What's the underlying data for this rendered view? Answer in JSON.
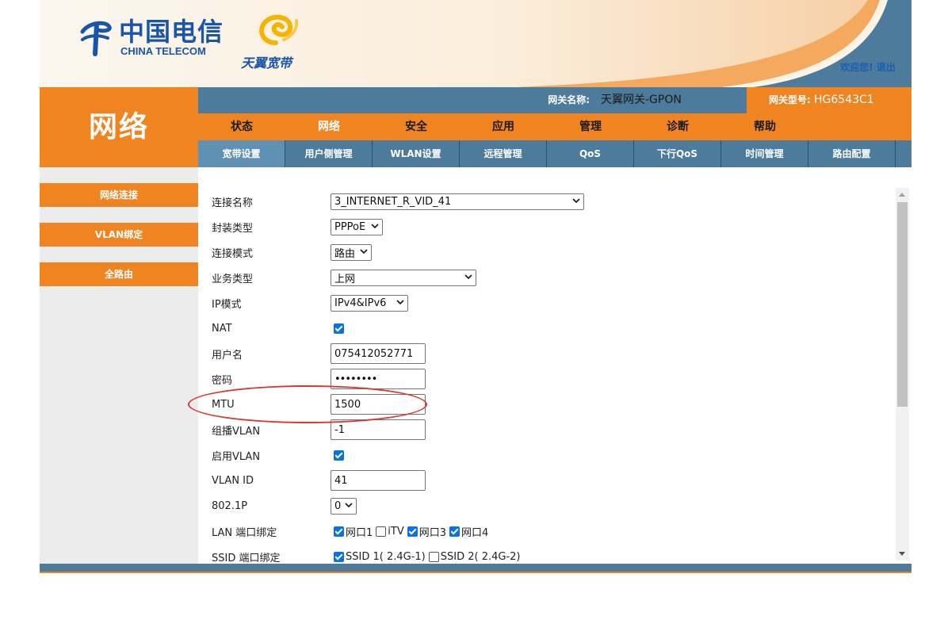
{
  "header": {
    "brand_cn": "中国电信",
    "brand_en": "CHINA TELECOM",
    "product_logo_text": "天翼宽带",
    "welcome": "欢迎您!",
    "logout": "退出"
  },
  "section_title": "网络",
  "gateway": {
    "name_label": "网关名称:",
    "name_value": "天翼网关-GPON",
    "model_label": "网关型号:",
    "model_value": "HG6543C1"
  },
  "main_nav": [
    "状态",
    "网络",
    "安全",
    "应用",
    "管理",
    "诊断",
    "帮助"
  ],
  "main_nav_active": "网络",
  "sub_nav": [
    "宽带设置",
    "用户侧管理",
    "WLAN设置",
    "远程管理",
    "QoS",
    "下行QoS",
    "时间管理",
    "路由配置"
  ],
  "sub_nav_active": "宽带设置",
  "sidebar": [
    "网络连接",
    "VLAN绑定",
    "全路由"
  ],
  "form": {
    "connection_name": {
      "label": "连接名称",
      "value": "3_INTERNET_R_VID_41"
    },
    "encap_type": {
      "label": "封装类型",
      "value": "PPPoE"
    },
    "conn_mode": {
      "label": "连接模式",
      "value": "路由"
    },
    "service_type": {
      "label": "业务类型",
      "value": "上网"
    },
    "ip_mode": {
      "label": "IP模式",
      "value": "IPv4&IPv6"
    },
    "nat": {
      "label": "NAT",
      "checked": true
    },
    "username": {
      "label": "用户名",
      "value": "075412052771"
    },
    "password": {
      "label": "密码",
      "value": "••••••••"
    },
    "mtu": {
      "label": "MTU",
      "value": "1500"
    },
    "multicast_vlan": {
      "label": "组播VLAN",
      "value": "-1"
    },
    "enable_vlan": {
      "label": "启用VLAN",
      "checked": true
    },
    "vlan_id": {
      "label": "VLAN ID",
      "value": "41"
    },
    "priority": {
      "label": "802.1P",
      "value": "0"
    },
    "lan_binding": {
      "label": "LAN 端口绑定",
      "options": [
        {
          "text": "网口1",
          "checked": true
        },
        {
          "text": "iTV",
          "checked": false
        },
        {
          "text": "网口3",
          "checked": true
        },
        {
          "text": "网口4",
          "checked": true
        }
      ]
    },
    "ssid_binding": {
      "label": "SSID 端口绑定",
      "options": [
        {
          "text": "SSID 1( 2.4G-1)",
          "checked": true
        },
        {
          "text": "SSID 2( 2.4G-2)",
          "checked": false
        }
      ]
    }
  },
  "colors": {
    "orange": "#ef8421",
    "steel_blue": "#4d7b9c",
    "brand_blue": "#1a55a8",
    "annotation_red": "#d9362c"
  }
}
